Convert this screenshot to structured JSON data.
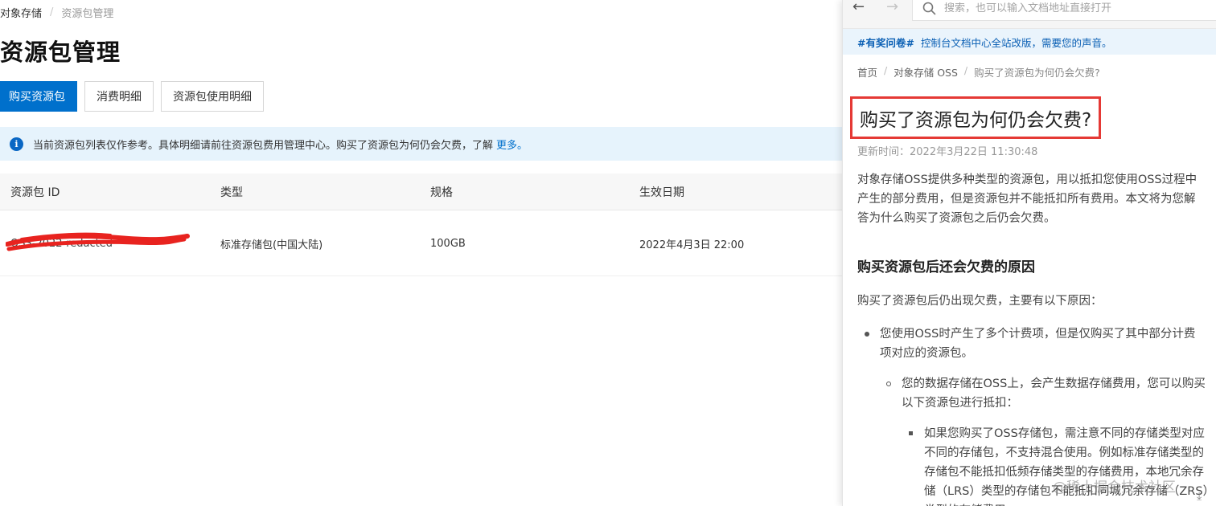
{
  "console": {
    "breadcrumb": {
      "root": "对象存储",
      "separator": "/",
      "current": "资源包管理"
    },
    "page_title": "资源包管理",
    "buttons": {
      "buy": "购买资源包",
      "consumption": "消费明细",
      "usage": "资源包使用明细"
    },
    "notice": {
      "icon": "i",
      "text": "当前资源包列表仅作参考。具体明细请前往资源包费用管理中心。购买了资源包为何仍会欠费，了解",
      "link": "更多。"
    },
    "table": {
      "headers": [
        "资源包 ID",
        "类型",
        "规格",
        "生效日期"
      ],
      "rows": [
        {
          "id": "OSS-2022-redacted",
          "type": "标准存储包(中国大陆)",
          "spec": "100GB",
          "date": "2022年4月3日 22:00"
        }
      ]
    },
    "colors": {
      "primary": "#0070cc",
      "notice_bg": "#e6f3fc"
    }
  },
  "doc": {
    "nav": {
      "back": "←",
      "forward": "→"
    },
    "search": {
      "placeholder": "搜索，也可以输入文档地址直接打开"
    },
    "announce": {
      "tag": "#有奖问卷#",
      "text": "控制台文档中心全站改版，需要您的声音。"
    },
    "crumbs": {
      "home": "首页",
      "sep": "/",
      "product": "对象存储 OSS",
      "current": "购买了资源包为何仍会欠费?"
    },
    "title": "购买了资源包为何仍会欠费?",
    "updated": "更新时间：2022年3月22日 11:30:48",
    "intro": "对象存储OSS提供多种类型的资源包，用以抵扣您使用OSS过程中产生的部分费用，但是资源包并不能抵扣所有费用。本文将为您解答为什么购买了资源包之后仍会欠费。",
    "section_title": "购买资源包后还会欠费的原因",
    "section_lead": "购买了资源包后仍出现欠费，主要有以下原因：",
    "bullets": {
      "level1": "您使用OSS时产生了多个计费项，但是仅购买了其中部分计费项对应的资源包。",
      "level2": "您的数据存储在OSS上，会产生数据存储费用，您可以购买以下资源包进行抵扣：",
      "level3": "如果您购买了OSS存储包，需注意不同的存储类型对应不同的存储包，不支持混合使用。例如标准存储类型的存储包不能抵扣低频存储类型的存储费用，本地冗余存储（LRS）类型的存储包不能抵扣同城冗余存储（ZRS）类型的存储费用。"
    },
    "watermark": "@稀土掘金技术社区",
    "highlight_color": "#e53935"
  }
}
